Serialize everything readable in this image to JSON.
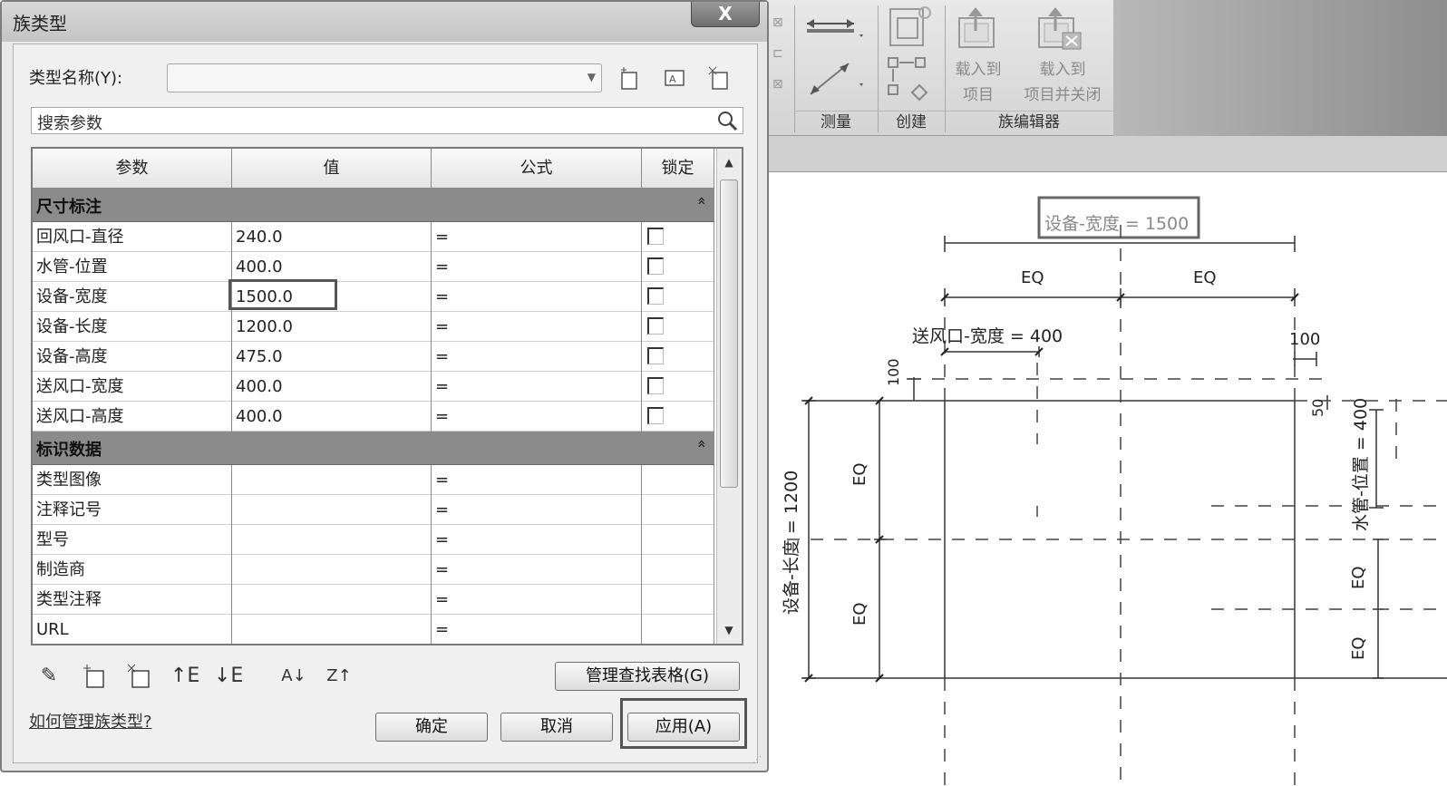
{
  "ribbon": {
    "panels": {
      "measure_label": "测量",
      "create_label": "创建",
      "family_editor_label": "族编辑器"
    },
    "load_into_project": {
      "line1": "载入到",
      "line2": "项目"
    },
    "load_into_project_close": {
      "line1": "载入到",
      "line2": "项目并关闭"
    }
  },
  "dialog": {
    "title": "族类型",
    "close_glyph": "X",
    "type_name_label": "类型名称(Y):",
    "type_name_value": "",
    "search_placeholder": "搜索参数",
    "columns": [
      "参数",
      "值",
      "公式",
      "锁定"
    ],
    "groups": [
      {
        "title": "尺寸标注",
        "rows": [
          {
            "param": "回风口-直径",
            "value": "240.0",
            "formula": "="
          },
          {
            "param": "水管-位置",
            "value": "400.0",
            "formula": "="
          },
          {
            "param": "设备-宽度",
            "value": "1500.0",
            "formula": "="
          },
          {
            "param": "设备-长度",
            "value": "1200.0",
            "formula": "="
          },
          {
            "param": "设备-高度",
            "value": "475.0",
            "formula": "="
          },
          {
            "param": "送风口-宽度",
            "value": "400.0",
            "formula": "="
          },
          {
            "param": "送风口-高度",
            "value": "400.0",
            "formula": "="
          }
        ]
      },
      {
        "title": "标识数据",
        "rows": [
          {
            "param": "类型图像",
            "value": "",
            "formula": "="
          },
          {
            "param": "注释记号",
            "value": "",
            "formula": "="
          },
          {
            "param": "型号",
            "value": "",
            "formula": "="
          },
          {
            "param": "制造商",
            "value": "",
            "formula": "="
          },
          {
            "param": "类型注释",
            "value": "",
            "formula": "="
          },
          {
            "param": "URL",
            "value": "",
            "formula": "="
          }
        ]
      }
    ],
    "collapse_glyph": "»",
    "manage_lookup_label": "管理查找表格(G)",
    "help_link": "如何管理族类型?",
    "ok_label": "确定",
    "cancel_label": "取消",
    "apply_label": "应用(A)"
  },
  "drawing": {
    "width_label": "设备-宽度 = 1500",
    "eq": "EQ",
    "air_supply_width_label": "送风口-宽度 = 400",
    "dim_100": "100",
    "dim_50": "50",
    "water_pipe_label": "水管-位置 = 400",
    "length_label": "设备-长度 = 1200"
  }
}
